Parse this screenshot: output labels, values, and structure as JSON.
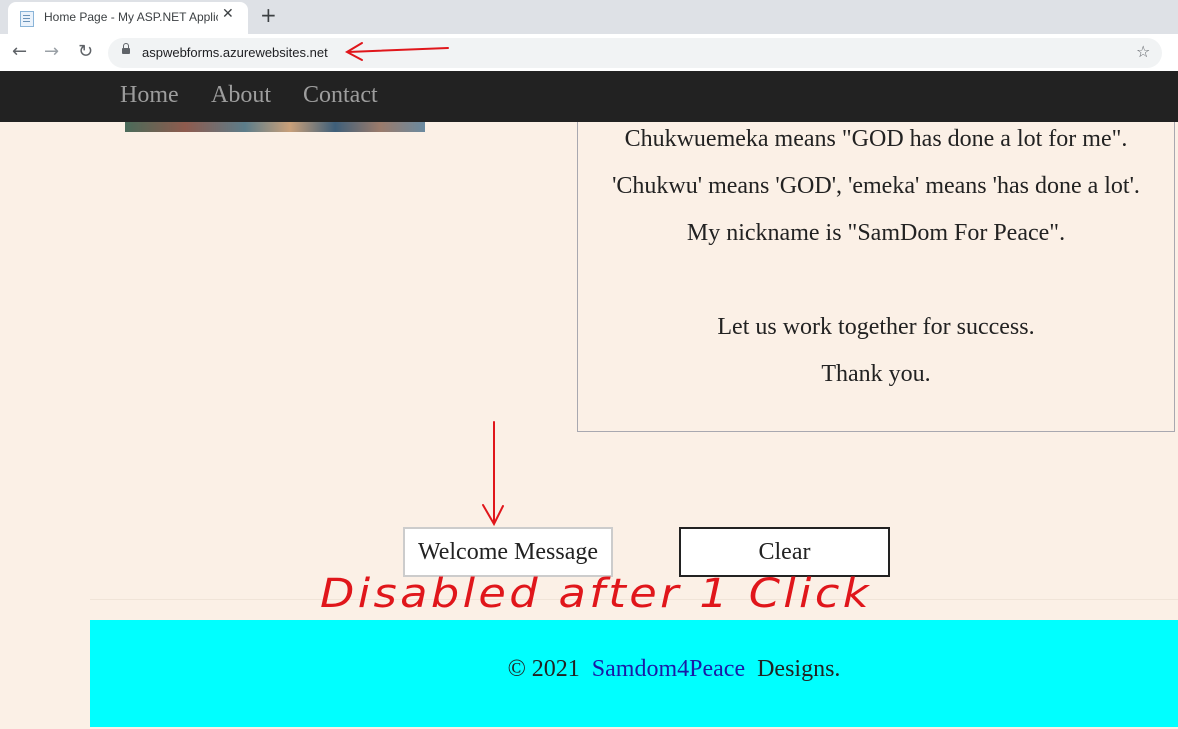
{
  "browser": {
    "tab_title": "Home Page - My ASP.NET Applic",
    "tab_close": "✕",
    "new_tab": "+",
    "back": "←",
    "forward": "→",
    "reload": "↻",
    "url": "aspwebforms.azurewebsites.net",
    "star": "☆"
  },
  "nav": {
    "items": [
      {
        "label": "Home"
      },
      {
        "label": "About"
      },
      {
        "label": "Contact"
      }
    ]
  },
  "content": {
    "lines": [
      "Chukwuemeka means \"GOD has done a lot for me\".",
      "'Chukwu' means 'GOD', 'emeka' means 'has done a lot'.",
      "My nickname is \"SamDom For Peace\".",
      "Let us work together for success.",
      "Thank you."
    ]
  },
  "buttons": {
    "welcome_label": "Welcome Message",
    "clear_label": "Clear"
  },
  "footer": {
    "copyright": "© 2021",
    "link": "Samdom4Peace",
    "suffix": "Designs."
  },
  "annotation": {
    "text": "Disabled after 1 Click",
    "color": "#e0161b"
  },
  "colors": {
    "page_bg": "#fbf0e6",
    "nav_bg": "#222222",
    "footer_bg": "#00ffff"
  }
}
